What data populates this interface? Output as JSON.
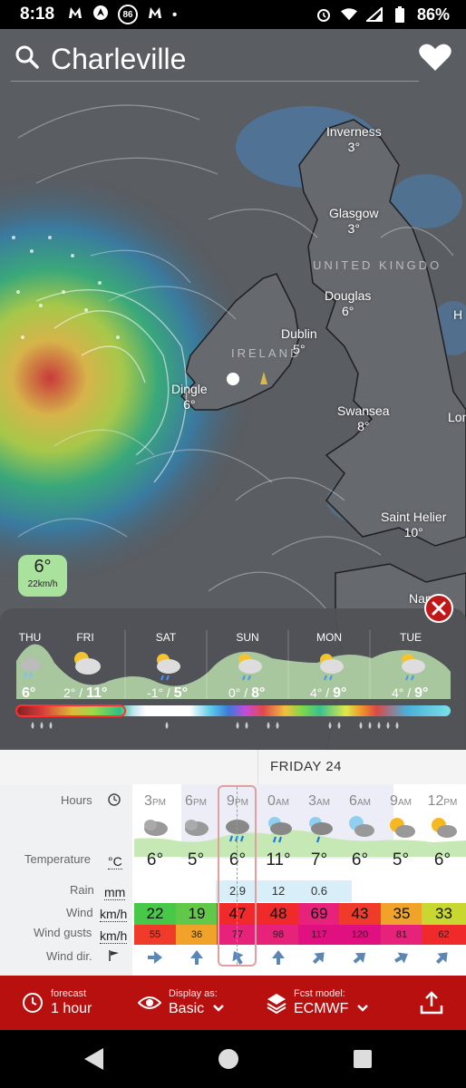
{
  "status_bar": {
    "time": "8:18",
    "left_icons": [
      "m-logo-icon",
      "compass-icon",
      "86-badge-icon",
      "m-logo-icon",
      "dot-icon"
    ],
    "badge_text": "86",
    "battery": "86%"
  },
  "search": {
    "location": "Charleville"
  },
  "map": {
    "cities": [
      {
        "name": "Inverness",
        "temp": "3°"
      },
      {
        "name": "Glasgow",
        "temp": "3°"
      },
      {
        "name": "Douglas",
        "temp": "6°"
      },
      {
        "name": "Dublin",
        "temp": "5°"
      },
      {
        "name": "Dingle",
        "temp": "6°"
      },
      {
        "name": "Swansea",
        "temp": "8°"
      },
      {
        "name": "Saint Helier",
        "temp": "10°"
      },
      {
        "name": "Nan",
        "temp": ""
      },
      {
        "name": "Lon",
        "temp": ""
      },
      {
        "name": "H",
        "temp": ""
      }
    ],
    "countries": [
      "IRELAND",
      "UNITED KINGDO"
    ],
    "bubble": {
      "temp": "6°",
      "wind": "22km/h"
    }
  },
  "strip": {
    "days": [
      {
        "label": "THU",
        "temps": "6°"
      },
      {
        "label": "FRI",
        "low": "2°",
        "high": "11°"
      },
      {
        "label": "SAT",
        "low": "-1°",
        "high": "5°"
      },
      {
        "label": "SUN",
        "low": "0°",
        "high": "8°"
      },
      {
        "label": "MON",
        "low": "4°",
        "high": "9°"
      },
      {
        "label": "TUE",
        "low": "4°",
        "high": "9°"
      }
    ],
    "slash": " / "
  },
  "table": {
    "date": "FRIDAY 24",
    "labels": {
      "hours": "Hours",
      "temperature": "Temperature",
      "temp_unit": "°C",
      "rain": "Rain",
      "rain_unit": "mm",
      "wind": "Wind",
      "wind_unit": "km/h",
      "gusts": "Wind gusts",
      "gusts_unit": "km/h",
      "dir": "Wind dir."
    },
    "hours": [
      {
        "h": "3",
        "ap": "PM"
      },
      {
        "h": "6",
        "ap": "PM"
      },
      {
        "h": "9",
        "ap": "PM"
      },
      {
        "h": "0",
        "ap": "AM"
      },
      {
        "h": "3",
        "ap": "AM"
      },
      {
        "h": "6",
        "ap": "AM"
      },
      {
        "h": "9",
        "ap": "AM"
      },
      {
        "h": "12",
        "ap": "PM"
      }
    ],
    "temps": [
      "6°",
      "5°",
      "6°",
      "11°",
      "7°",
      "6°",
      "5°",
      "6°"
    ],
    "rain": [
      "",
      "",
      "2.9",
      "12",
      "0.6",
      "",
      "",
      ""
    ],
    "wind": [
      "22",
      "19",
      "47",
      "48",
      "69",
      "43",
      "35",
      "33"
    ],
    "wind_colors": [
      "#48c848",
      "#62c84a",
      "#f02a2a",
      "#f02a2a",
      "#e6227a",
      "#f03a2a",
      "#f0a22a",
      "#c8d830"
    ],
    "gusts": [
      "55",
      "36",
      "77",
      "98",
      "117",
      "120",
      "81",
      "62"
    ],
    "gust_colors": [
      "#f03a2a",
      "#f0a22a",
      "#e6227a",
      "#e6227a",
      "#e01080",
      "#e01080",
      "#e6227a",
      "#f02a2a"
    ],
    "wind_dir_deg": [
      90,
      0,
      -30,
      0,
      45,
      50,
      60,
      45
    ]
  },
  "toolbar": {
    "forecast_small": "forecast",
    "forecast_big": "1 hour",
    "display_small": "Display as:",
    "display_big": "Basic",
    "model_small": "Fcst model:",
    "model_big": "ECMWF"
  }
}
